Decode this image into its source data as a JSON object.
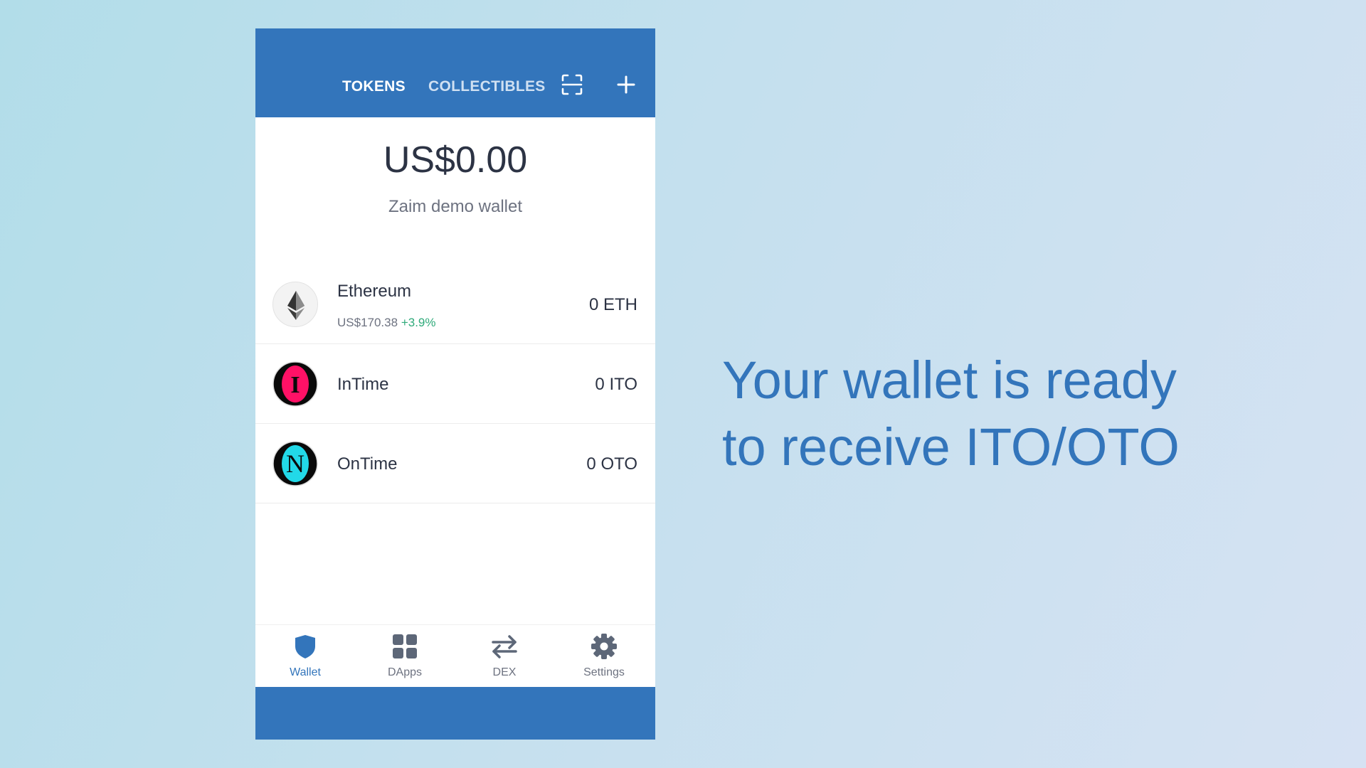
{
  "header": {
    "tabs": [
      {
        "label": "TOKENS",
        "active": true
      },
      {
        "label": "COLLECTIBLES",
        "active": false
      }
    ],
    "actions": [
      "scan-icon",
      "add-icon"
    ]
  },
  "summary": {
    "balance": "US$0.00",
    "wallet_name": "Zaim demo wallet"
  },
  "tokens": [
    {
      "name": "Ethereum",
      "price": "US$170.38",
      "change": "+3.9%",
      "amount": "0 ETH",
      "icon": "ethereum-logo"
    },
    {
      "name": "InTime",
      "amount": "0 ITO",
      "icon": "intime-logo",
      "logo_letter": "I",
      "logo_color": "#ff1166"
    },
    {
      "name": "OnTime",
      "amount": "0 OTO",
      "icon": "ontime-logo",
      "logo_letter": "N",
      "logo_color": "#22d9e8"
    }
  ],
  "bottom_nav": [
    {
      "label": "Wallet",
      "icon": "shield-icon",
      "active": true
    },
    {
      "label": "DApps",
      "icon": "grid-icon",
      "active": false
    },
    {
      "label": "DEX",
      "icon": "swap-arrows-icon",
      "active": false
    },
    {
      "label": "Settings",
      "icon": "gear-icon",
      "active": false
    }
  ],
  "headline": {
    "line1": "Your wallet is ready",
    "line2": "to receive ITO/OTO"
  },
  "colors": {
    "brand": "#3375bb",
    "positive": "#2faa7a",
    "text_primary": "#2c3344",
    "text_secondary": "#6d7280"
  }
}
